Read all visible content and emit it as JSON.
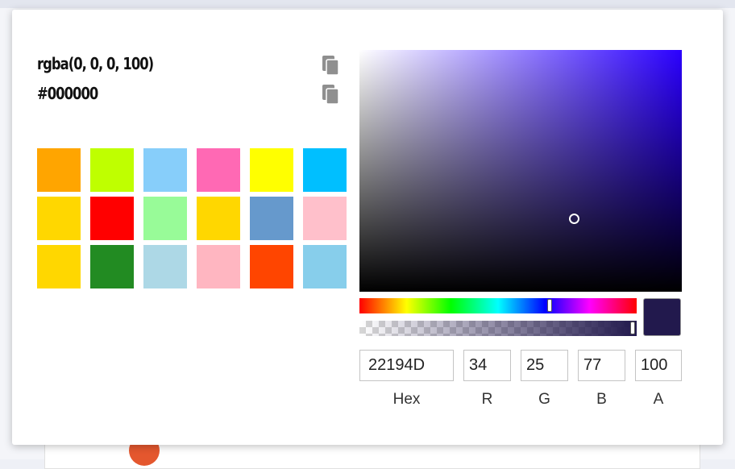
{
  "color_output": {
    "rgba_text": "rgba(0, 0, 0, 100)",
    "hex_text": "#000000",
    "copy_icon": "copy-icon"
  },
  "swatches": [
    "#ffa500",
    "#bfff00",
    "#87cefa",
    "#ff69b4",
    "#ffff00",
    "#00bfff",
    "#ffd700",
    "#ff0000",
    "#98fb98",
    "#ffd700",
    "#6699cc",
    "#ffc0cb",
    "#ffd700",
    "#228b22",
    "#add8e6",
    "#ffb6c1",
    "#ff4500",
    "#87ceeb"
  ],
  "picker": {
    "hue_color": "#2b00ff",
    "hue_value_fraction": 0.69,
    "alpha_value_fraction": 1.0,
    "preview_color": "#22194d"
  },
  "fields": {
    "hex": {
      "value": "22194D",
      "label": "Hex"
    },
    "r": {
      "value": "34",
      "label": "R"
    },
    "g": {
      "value": "25",
      "label": "G"
    },
    "b": {
      "value": "77",
      "label": "B"
    },
    "a": {
      "value": "100",
      "label": "A"
    }
  }
}
